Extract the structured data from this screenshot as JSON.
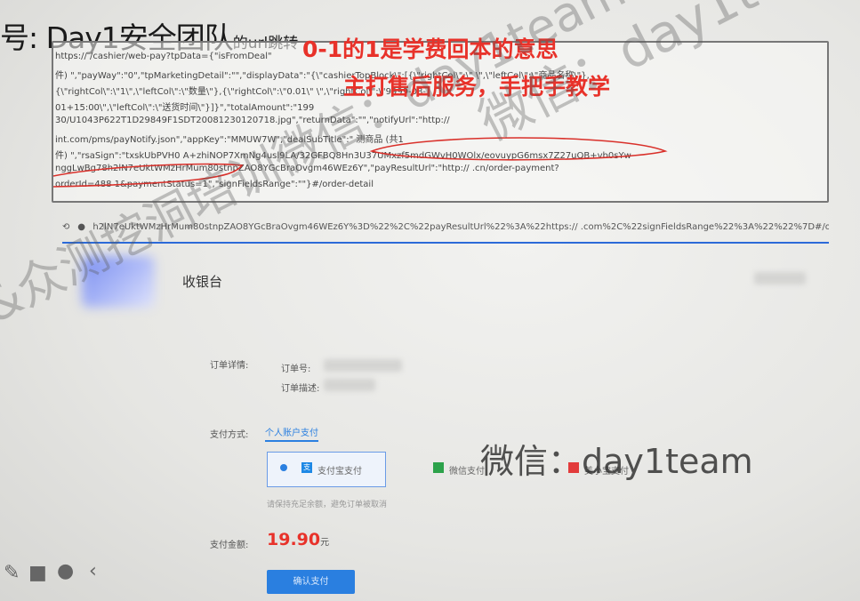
{
  "header": {
    "title_prefix": "号:",
    "title_main": "Day1安全团队",
    "title_small": "的url跳转"
  },
  "overlay": {
    "line1": "0-1的1是学费回本的意思",
    "line2": "主打售后服务，手把手教学"
  },
  "code": {
    "lines": [
      "https://                    /cashier/web-pay?tpData={\"isFromDeal\"                                                                                                                 ",
      "件) \",\"payWay\":\"0\",\"tpMarketingDetail\":\"\",\"displayData\":\"{\\\"cashierTopBlock\\\":[{\\\"rightCol\\\":\\\"                                                  \\\",\\\"leftCol\\\":\\\"商品名称\\\"},",
      "{\\\"rightCol\\\":\\\"1\\\",\\\"leftCol\\\":\\\"数量\\\"},{\\\"rightCol\\\":\\\"0.01\\\"                                                                          \\\",\\\"rightCol\\\":\\\"9999-08-",
      "01+15:00\\\",\\\"leftCol\\\":\\\"送货时间\\\"}]}\",\"totalAmount\":\"199                                                                          ",
      "30/U1043P622T1D29849F1SDT20081230120718.jpg\",\"returnData\":\"\",\"notifyUrl\":\"http://",
      "int.com/pms/payNotify.json\",\"appKey\":\"MMUW7W\",\"dealSubTitle\":\"                     测商品 (共1",
      "件) \",\"rsaSign\":\"txskUbPVH0                                              A+zhiNOP7XmNg4usl9LA/32GFBQ8Hn3U37UMxzf5mdGWvH0WOlx/eovuypG6msx7Z27uQB+vb0sYw",
      "nggLwBg78h2lN7eUktWMzHrMum80stnpZAO8YGcBraOvgm46WEz6Y\",\"payResultUrl\":\"http://                            .cn/order-payment?",
      "orderId=488                 1&paymentStatus=1\",\"signFieldsRange\":\"\"}#/order-detail"
    ]
  },
  "url_bar": {
    "text": "h2lN7eUktWMzHrMum80stnpZAO8YGcBraOvgm46WEz6Y%3D%22%2C%22payResultUrl%22%3A%22https://             .com%2C%22signFieldsRange%22%3A%22%22%7D#/order-detail"
  },
  "cashier": {
    "title": "收银台",
    "order_detail_label": "订单详情:",
    "order_no_label": "订单号:",
    "order_desc_label": "订单描述:",
    "pay_method_label": "支付方式:",
    "personal_tab": "个人账户支付",
    "options": [
      {
        "label": "支付宝支付",
        "icon": "alipay-icon",
        "selected": true
      },
      {
        "label": "微信支付",
        "icon": "wechat-icon",
        "selected": false
      },
      {
        "label": "美小宝支付",
        "icon": "meixiaobao-icon",
        "selected": false
      }
    ],
    "hint": "请保持充足余额，避免订单被取消",
    "amount_label": "支付金额:",
    "amount_value": "19.90",
    "amount_unit": "元",
    "confirm_button": "确认支付"
  },
  "watermarks": {
    "diagonal1": "&众测挖洞培训微信：day1team",
    "diagonal2": "微信：day1team",
    "horizontal": "微信：day1team"
  },
  "colors": {
    "accent_red": "#e8322a",
    "accent_blue": "#2a7fe0"
  }
}
